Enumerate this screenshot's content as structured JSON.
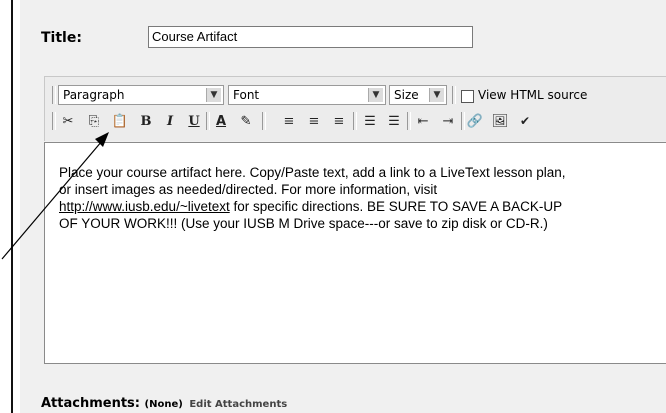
{
  "form": {
    "title_label": "Title:",
    "title_value": "Course Artifact"
  },
  "toolbar": {
    "format_select": "Paragraph",
    "font_select": "Font",
    "size_select": "Size",
    "view_html_label": "View HTML source",
    "bold": "B",
    "italic": "I",
    "underline": "U",
    "font_color": "A"
  },
  "editor": {
    "line1": "Place your course artifact here.  Copy/Paste text, add a link to a LiveText lesson plan,",
    "line2": "or insert images as needed/directed.  For more information, visit",
    "link": "http://www.iusb.edu/~livetext",
    "line3_rest": " for specific directions.  BE SURE TO SAVE A BACK-UP",
    "line4": "OF YOUR WORK!!!  (Use your IUSB M Drive space---or save to zip disk or CD-R.)"
  },
  "attachments": {
    "label": "Attachments:",
    "value": "(None)",
    "edit_link": "Edit Attachments"
  }
}
